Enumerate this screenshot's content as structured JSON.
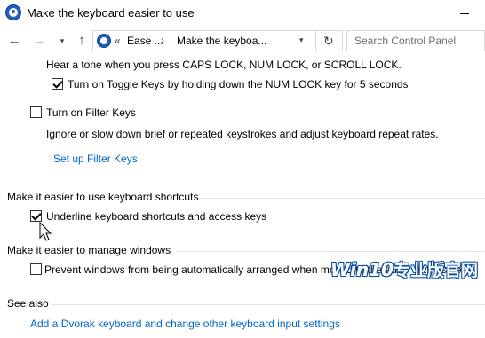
{
  "window": {
    "title": "Make the keyboard easier to use",
    "app_icon": "ease-of-access-icon",
    "minimize_icon": "minimize-icon"
  },
  "nav": {
    "back_icon": "back-arrow-icon",
    "forward_icon": "forward-arrow-icon",
    "recent_icon": "chevron-down-icon",
    "up_icon": "up-arrow-icon",
    "back_glyph": "←",
    "forward_glyph": "→",
    "recent_glyph": "▾",
    "up_glyph": "↑"
  },
  "address": {
    "prefix": "«",
    "crumbs": [
      "Ease ...",
      "Make the keyboa..."
    ],
    "separator": "›",
    "dropdown_glyph": "▾",
    "refresh_glyph": "↻"
  },
  "search": {
    "placeholder": "Search Control Panel"
  },
  "content": {
    "toggle_keys_desc": "Hear a tone when you press CAPS LOCK, NUM LOCK, or SCROLL LOCK.",
    "toggle_keys_shortcut": {
      "label": "Turn on Toggle Keys by holding down the NUM LOCK key for 5 seconds",
      "checked": true
    },
    "filter_keys": {
      "label": "Turn on Filter Keys",
      "checked": false
    },
    "filter_keys_desc": "Ignore or slow down brief or repeated keystrokes and adjust keyboard repeat rates.",
    "filter_keys_link": "Set up Filter Keys",
    "shortcuts_section": "Make it easier to use keyboard shortcuts",
    "underline_shortcuts": {
      "label": "Underline keyboard shortcuts and access keys",
      "checked": true
    },
    "windows_section": "Make it easier to manage windows",
    "prevent_arrange": {
      "label": "Prevent windows from being automatically arranged when moved to the edge of the screen",
      "checked": false
    },
    "see_also": "See also",
    "dvorak_link": "Add a Dvorak keyboard and change other keyboard input settings"
  },
  "watermark": {
    "text_a": "Win10",
    "text_b": "专业版官网"
  }
}
